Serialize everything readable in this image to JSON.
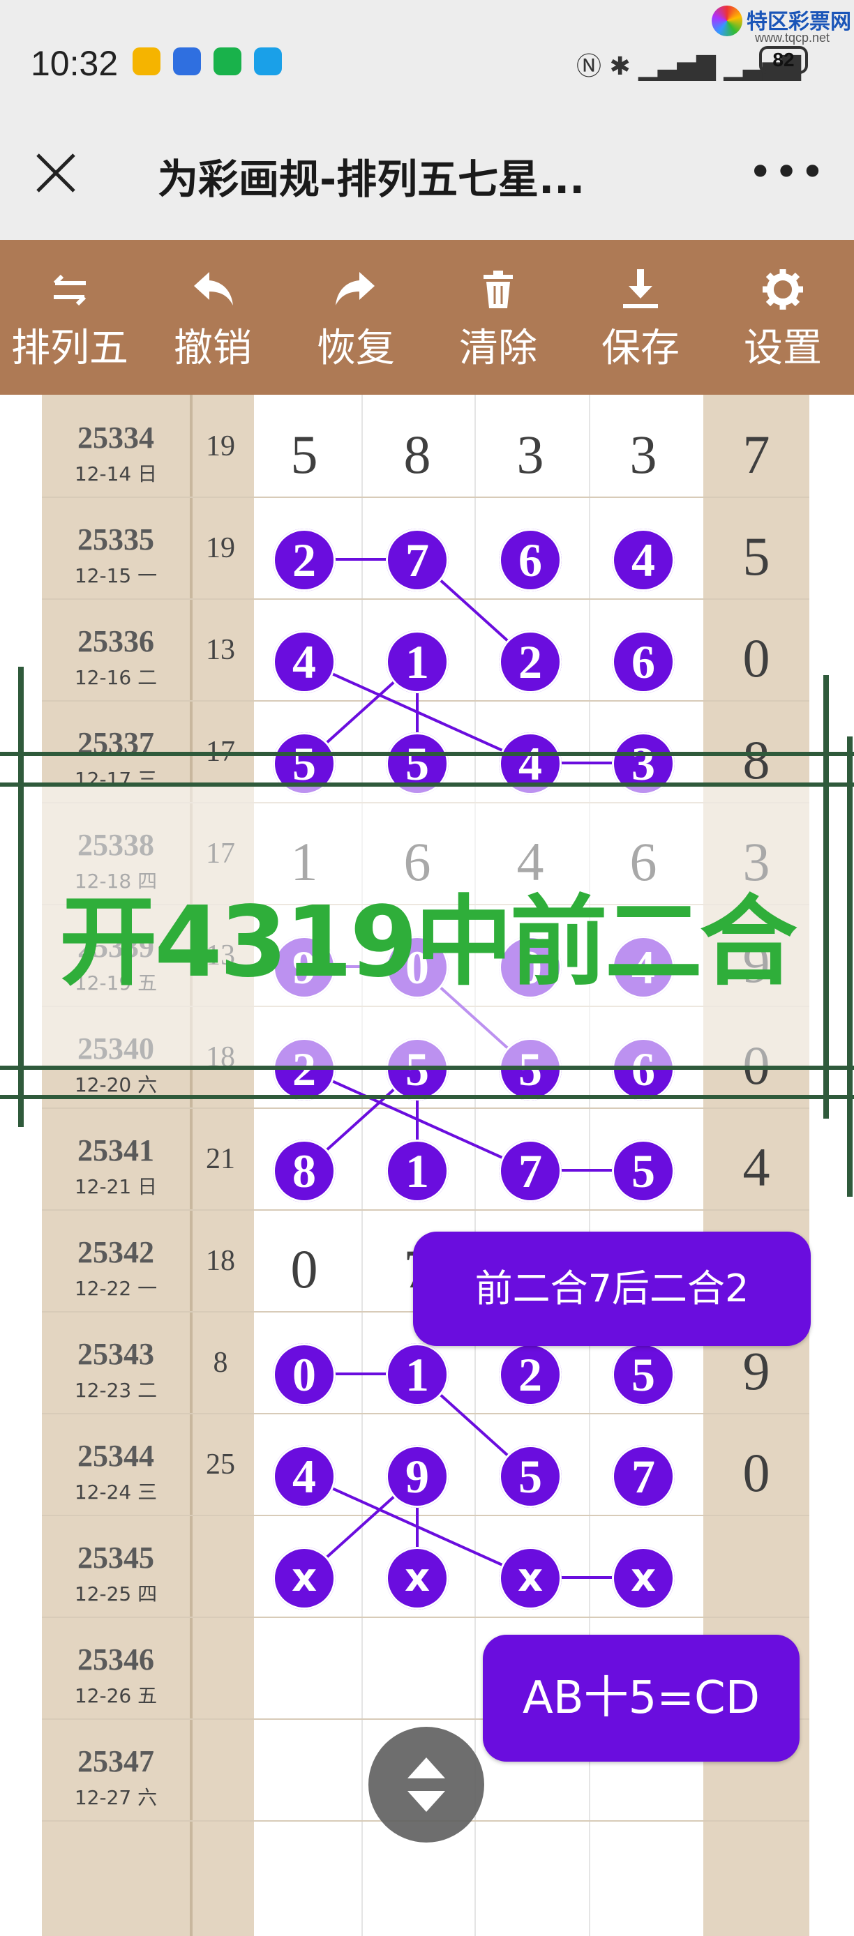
{
  "status_bar": {
    "time": "10:32",
    "battery": "82"
  },
  "watermark": {
    "name": "特区彩票网",
    "url": "www.tqcp.net"
  },
  "header": {
    "title": "为彩画规-排列五七星..."
  },
  "toolbar": {
    "items": [
      {
        "label": "排列五",
        "icon": "swap-arrows-icon"
      },
      {
        "label": "撤销",
        "icon": "undo-icon"
      },
      {
        "label": "恢复",
        "icon": "redo-icon"
      },
      {
        "label": "清除",
        "icon": "trash-icon"
      },
      {
        "label": "保存",
        "icon": "download-icon"
      },
      {
        "label": "设置",
        "icon": "gear-icon"
      }
    ]
  },
  "rows": [
    {
      "period": "25334",
      "date": "12-14 日",
      "sum": "19",
      "digits": [
        "5",
        "8",
        "3",
        "3",
        "7"
      ]
    },
    {
      "period": "25335",
      "date": "12-15 一",
      "sum": "19",
      "digits": [
        "2",
        "7",
        "6",
        "4",
        "5"
      ]
    },
    {
      "period": "25336",
      "date": "12-16 二",
      "sum": "13",
      "digits": [
        "4",
        "1",
        "2",
        "6",
        "0"
      ]
    },
    {
      "period": "25337",
      "date": "12-17 三",
      "sum": "17",
      "digits": [
        "5",
        "5",
        "4",
        "3",
        "8"
      ]
    },
    {
      "period": "25338",
      "date": "12-18 四",
      "sum": "17",
      "digits": [
        "1",
        "6",
        "4",
        "6",
        "3"
      ]
    },
    {
      "period": "25339",
      "date": "12-19 五",
      "sum": "13",
      "digits": [
        "9",
        "0",
        "0",
        "4",
        "9"
      ]
    },
    {
      "period": "25340",
      "date": "12-20 六",
      "sum": "18",
      "digits": [
        "2",
        "5",
        "5",
        "6",
        "0"
      ]
    },
    {
      "period": "25341",
      "date": "12-21 日",
      "sum": "21",
      "digits": [
        "8",
        "1",
        "7",
        "5",
        "4"
      ]
    },
    {
      "period": "25342",
      "date": "12-22 一",
      "sum": "18",
      "digits": [
        "0",
        "7",
        "",
        "",
        ""
      ]
    },
    {
      "period": "25343",
      "date": "12-23 二",
      "sum": "8",
      "digits": [
        "0",
        "1",
        "2",
        "5",
        "9"
      ]
    },
    {
      "period": "25344",
      "date": "12-24 三",
      "sum": "25",
      "digits": [
        "4",
        "9",
        "5",
        "7",
        "0"
      ]
    },
    {
      "period": "25345",
      "date": "12-25 四",
      "sum": "",
      "digits": [
        "x",
        "x",
        "x",
        "x",
        ""
      ]
    },
    {
      "period": "25346",
      "date": "12-26 五",
      "sum": "",
      "digits": [
        "",
        "",
        "",
        "",
        ""
      ]
    },
    {
      "period": "25347",
      "date": "12-27 六",
      "sum": "",
      "digits": [
        "",
        "",
        "",
        "",
        ""
      ]
    }
  ],
  "overlay": {
    "text": "开4319中前二合"
  },
  "callouts": {
    "first": "前二合7后二合2",
    "second": "AB十5=CD"
  },
  "colors": {
    "ball": "#6a0dde",
    "toolbar": "#ae7a55",
    "overlay_text": "#2fae3a"
  }
}
